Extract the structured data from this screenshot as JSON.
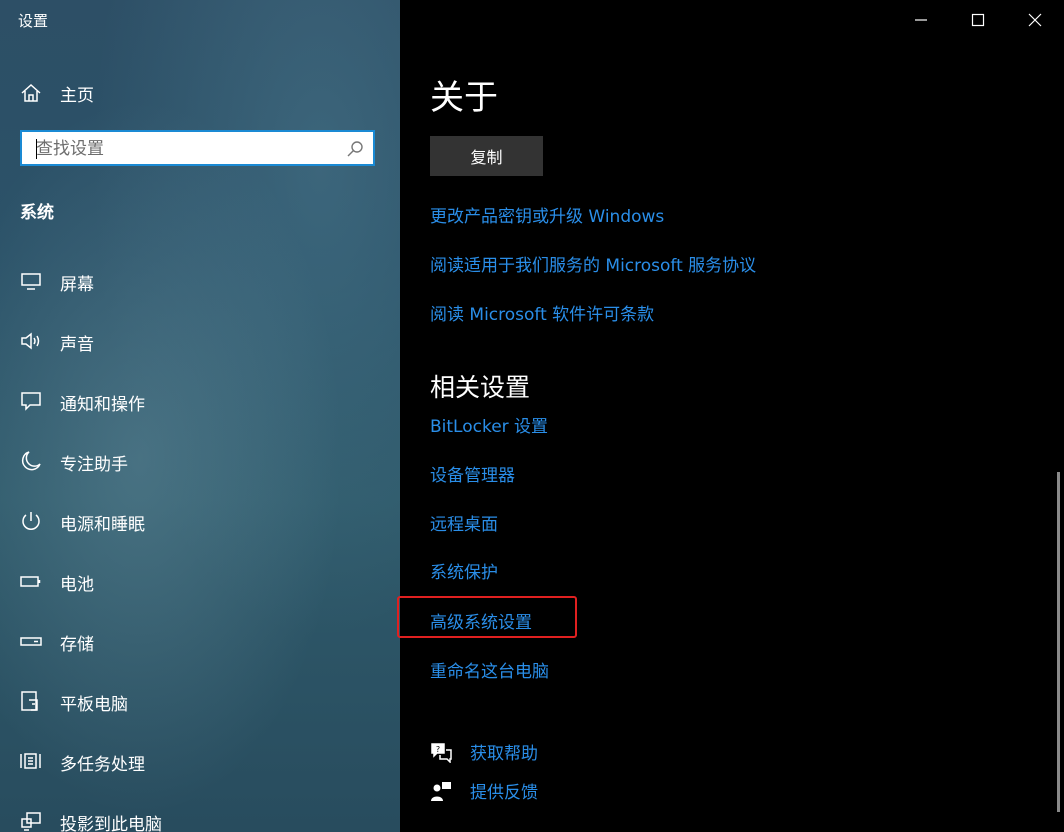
{
  "window": {
    "title": "设置"
  },
  "sidebar": {
    "home_label": "主页",
    "search": {
      "placeholder": "查找设置"
    },
    "section_title": "系统",
    "items": [
      {
        "label": "屏幕",
        "icon": "display-icon"
      },
      {
        "label": "声音",
        "icon": "speaker-icon"
      },
      {
        "label": "通知和操作",
        "icon": "notification-icon"
      },
      {
        "label": "专注助手",
        "icon": "moon-icon"
      },
      {
        "label": "电源和睡眠",
        "icon": "power-icon"
      },
      {
        "label": "电池",
        "icon": "battery-icon"
      },
      {
        "label": "存储",
        "icon": "storage-icon"
      },
      {
        "label": "平板电脑",
        "icon": "tablet-icon"
      },
      {
        "label": "多任务处理",
        "icon": "multitasking-icon"
      },
      {
        "label": "投影到此电脑",
        "icon": "project-icon"
      }
    ]
  },
  "main": {
    "title": "关于",
    "copy_button": "复制",
    "links": [
      "更改产品密钥或升级 Windows",
      "阅读适用于我们服务的 Microsoft 服务协议",
      "阅读 Microsoft 软件许可条款"
    ],
    "related_title": "相关设置",
    "related_links": [
      "BitLocker 设置",
      "设备管理器",
      "远程桌面",
      "系统保护",
      "高级系统设置",
      "重命名这台电脑"
    ],
    "highlighted_link": "高级系统设置",
    "help": {
      "get_help": "获取帮助",
      "feedback": "提供反馈"
    }
  },
  "colors": {
    "link": "#2a8ee8",
    "highlight": "#e02020",
    "search_border": "#1a8ad4",
    "button_bg": "#333333"
  }
}
